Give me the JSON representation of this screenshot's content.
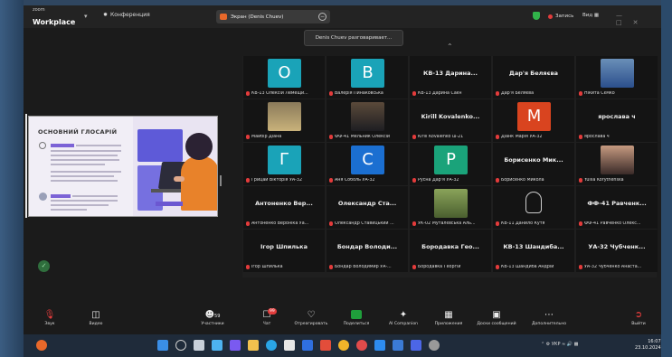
{
  "topbar": {
    "brand_top": "zoom",
    "brand_name": "Workplace",
    "conference_label": "Конференция",
    "screen_label": "Экран (Denis Chuev)",
    "recording_label": "Запись",
    "view_label": "Вид"
  },
  "toast": {
    "text": "Denis Chuev разговаривает..."
  },
  "shared_screen": {
    "title": "ОСНОВНИЙ ГЛОСАРІЙ"
  },
  "tiles": [
    {
      "avatar": "О",
      "color": "#1aa3b8",
      "caption": "КВ-13 Олексій Лемещи..."
    },
    {
      "avatar": "В",
      "color": "#1aa3b8",
      "caption": "Валерія Пинаковська"
    },
    {
      "big_name": "КВ-13 Дарина...",
      "caption": "КВ-13 Дарина Саєн"
    },
    {
      "big_name": "Дар'я Беляєва",
      "caption": "Дар'я Беляєва"
    },
    {
      "photo": "photo-blue-jersey",
      "caption": "Нікита Сємко"
    },
    {
      "photo": "photo-woman-blonde",
      "caption": "Майбір Діана"
    },
    {
      "photo": "photo-man-suit",
      "caption": "ФФ-41 Мельник Олексій"
    },
    {
      "big_name": "Kirill Kovalenko...",
      "caption": "Kirill Kovalenko ш-21"
    },
    {
      "avatar": "М",
      "color": "#d9441f",
      "caption": "Діанк Марія УА-32"
    },
    {
      "big_name": "ярослава ч",
      "caption": "ярослава ч"
    },
    {
      "avatar": "Г",
      "color": "#1aa3b8",
      "caption": "Грицай Вікторія УА-32"
    },
    {
      "avatar": "С",
      "color": "#1b6fd1",
      "caption": "Аня Соболь УА-32"
    },
    {
      "avatar": "Р",
      "color": "#1aa37a",
      "caption": "Русна Дар'я УА-32"
    },
    {
      "big_name": "Борисенко Мик...",
      "caption": "Борисенко Микола"
    },
    {
      "photo": "photo-woman-dark",
      "caption": "Yuliia Korytnenska"
    },
    {
      "big_name": "Антоненко Вер...",
      "caption": "Антоненко Вероніка Уа..."
    },
    {
      "big_name": "Олександр Ста...",
      "caption": "Олександр Ставицький ..."
    },
    {
      "photo": "photo-man-outdoor",
      "caption": "УК-02 Муталєвська Аль..."
    },
    {
      "outline": true,
      "caption": "КВ-11 Данило Кутя"
    },
    {
      "big_name": "ФФ-41 Равченк...",
      "caption": "ФФ-41 Равченко Олекс..."
    },
    {
      "big_name": "Ігор Шпилька",
      "caption": "Ігор Шпилька"
    },
    {
      "big_name": "Бондар Володи...",
      "caption": "Бондар Володимир УА-..."
    },
    {
      "big_name": "Бородавка Гео...",
      "caption": "Бородавка Георгій"
    },
    {
      "big_name": "КВ-13 Шандиба...",
      "caption": "КВ-13 Шандиба Андрій"
    },
    {
      "big_name": "УА-32 Чубченк...",
      "caption": "УА-32 Чубченко Анаста..."
    }
  ],
  "toolbar": {
    "audio": "Звук",
    "video": "Видео",
    "participants": "Участники",
    "participants_count": "59",
    "chat": "Чат",
    "chat_badge": "99",
    "react": "Отреагировать",
    "share": "Поделиться",
    "ai": "AI Companion",
    "apps": "Приложения",
    "whiteboards": "Доски сообщений",
    "more": "Дополнительно",
    "leave": "Выйти"
  },
  "taskbar": {
    "lang": "УКР",
    "time": "16:07",
    "date": "23.10.2024"
  }
}
